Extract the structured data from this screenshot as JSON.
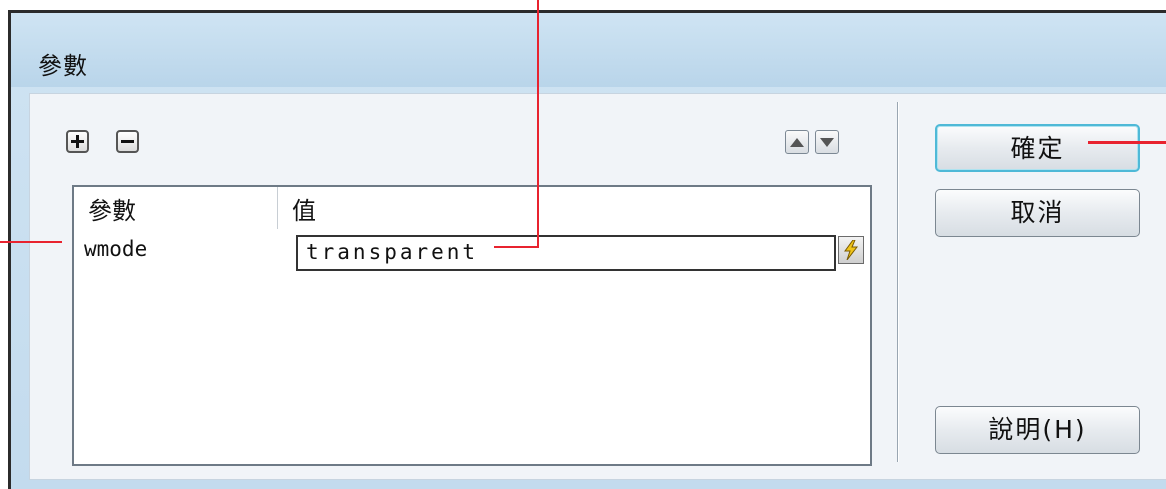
{
  "dialog": {
    "title": "參數"
  },
  "toolbar": {
    "add_icon": "plus-icon",
    "remove_icon": "minus-icon",
    "move_up_icon": "triangle-up-icon",
    "move_down_icon": "triangle-down-icon"
  },
  "table": {
    "columns": [
      "參數",
      "值"
    ],
    "rows": [
      {
        "name": "wmode",
        "value": "transparent",
        "dynamic_icon": "lightning-bolt-icon"
      }
    ]
  },
  "buttons": {
    "ok": "確定",
    "cancel": "取消",
    "help": "說明(H)"
  },
  "colors": {
    "annotation": "#e8232f",
    "dialog_background": "#cfe3f2",
    "default_button_border": "#4fb9d7"
  }
}
